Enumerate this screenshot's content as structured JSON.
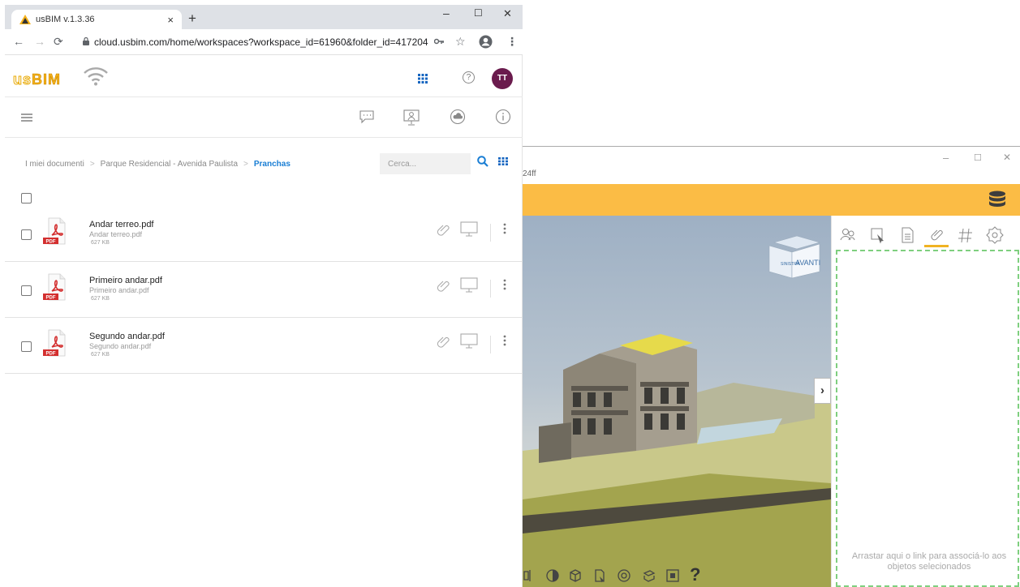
{
  "browser": {
    "tab_title": "usBIM v.1.3.36",
    "tab_close": "×",
    "new_tab": "+",
    "url": "cloud.usbim.com/home/workspaces?workspace_id=61960&folder_id=417204",
    "window_min": "–",
    "window_max": "☐",
    "window_close": "✕"
  },
  "app": {
    "logo_us": "us",
    "logo_bim": "BIM",
    "help": "?",
    "avatar_initials": "TT",
    "brand_color": "#f6b21b",
    "avatar_color": "#6a1b4d"
  },
  "breadcrumb": {
    "items": [
      "I miei documenti",
      "Parque Residencial - Avenida Paulista"
    ],
    "current": "Pranchas"
  },
  "search": {
    "placeholder": "Cerca..."
  },
  "files": [
    {
      "name": "Andar terreo.pdf",
      "subtitle": "Andar terreo.pdf",
      "size": "627 KB"
    },
    {
      "name": "Primeiro andar.pdf",
      "subtitle": "Primeiro andar.pdf",
      "size": "627 KB"
    },
    {
      "name": "Segundo andar.pdf",
      "subtitle": "Segundo andar.pdf",
      "size": "627 KB"
    }
  ],
  "viewer": {
    "subtitle_fragment": "24ff",
    "cube_left": "SINISTRA",
    "cube_front": "AVANTI",
    "expand": "›",
    "help": "?",
    "drop_text": "Arrastar aqui o link para associá-lo aos objetos selecionados",
    "accent_color": "#fbbc45"
  }
}
